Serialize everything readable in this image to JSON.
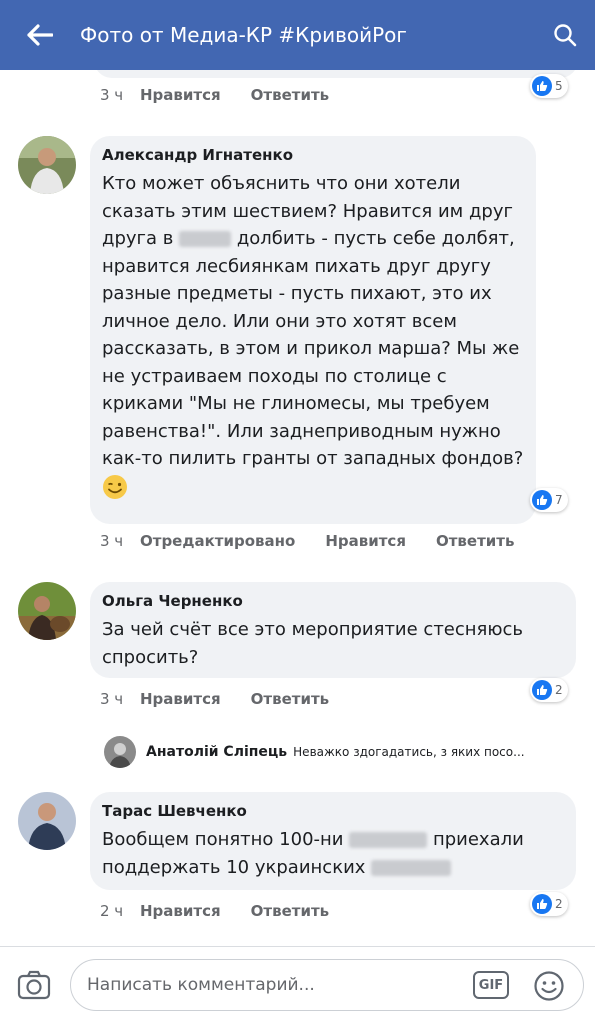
{
  "header": {
    "title": "Фото от Медиа-КР #КривойРог",
    "back_icon": "arrow-left-icon",
    "search_icon": "search-icon",
    "background": "#4267b2"
  },
  "comments": [
    {
      "time": "3 ч",
      "like": "Нравится",
      "reply": "Ответить",
      "reactions": "5"
    },
    {
      "author": "Александр Игнатенко",
      "text_parts": [
        "Кто может объяснить что они хотели сказать этим шествием? Нравится им друг друга в",
        "долбить - пусть себе долбят, нравится лесбиянкам пихать друг другу разные предметы - пусть пихают, это их личное дело. Или они это хотят всем рассказать, в этом и прикол марша? Мы же не устраиваем походы по столице с криками \"Мы не глиномесы, мы требуем равенства!\". Или заднеприводным нужно как-то пилить гранты от западных фондов?"
      ],
      "emoji": "wink-smile-icon",
      "time": "3 ч",
      "edited": "Отредактировано",
      "like": "Нравится",
      "reply": "Ответить",
      "reactions": "7"
    },
    {
      "author": "Ольга Черненко",
      "text": "За чей счёт все это мероприятие стесняюсь спросить?",
      "time": "3 ч",
      "like": "Нравится",
      "reply": "Ответить",
      "reactions": "2",
      "reply_preview": {
        "author": "Анатолій Сліпець",
        "text": "Неважко здогадатись, з яких посо..."
      }
    },
    {
      "author": "Тарас Шевченко",
      "text_parts": [
        "Вообщем понятно 100-ни",
        "приехали поддержать 10 украинских"
      ],
      "time": "2 ч",
      "like": "Нравится",
      "reply": "Ответить",
      "reactions": "2"
    }
  ],
  "composer": {
    "placeholder": "Написать комментарий...",
    "gif_label": "GIF",
    "camera_icon": "camera-icon",
    "emoji_icon": "smiley-icon"
  }
}
